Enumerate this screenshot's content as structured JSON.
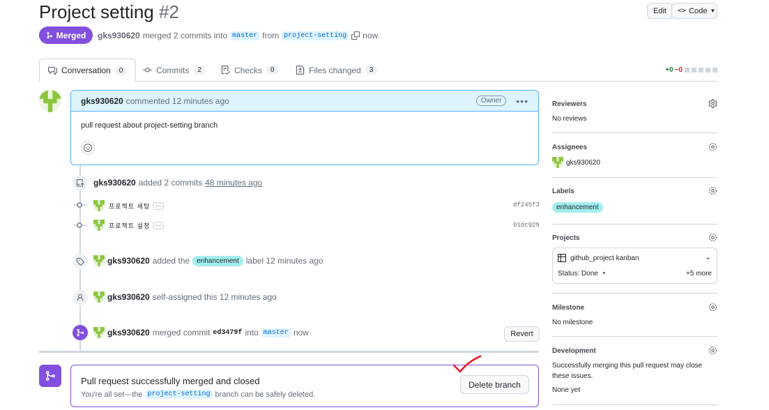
{
  "header": {
    "title": "Project setting",
    "number": "#2",
    "edit_label": "Edit",
    "code_label": "Code"
  },
  "pr_status": {
    "badge": "Merged",
    "user": "gks930620",
    "text_merged": "merged 2 commits into",
    "base_branch": "master",
    "text_from": "from",
    "head_branch": "project-setting",
    "time": "now"
  },
  "tabs": [
    {
      "label": "Conversation",
      "count": "0"
    },
    {
      "label": "Commits",
      "count": "2"
    },
    {
      "label": "Checks",
      "count": "0"
    },
    {
      "label": "Files changed",
      "count": "3"
    }
  ],
  "diffstat": {
    "add": "+0",
    "del": "−0"
  },
  "comment": {
    "user": "gks930620",
    "meta": "commented 12 minutes ago",
    "role": "Owner",
    "body": "pull request about project-setting branch"
  },
  "timeline": {
    "commits_event": {
      "user": "gks930620",
      "text": "added 2 commits",
      "time": "48 minutes ago"
    },
    "commits": [
      {
        "message": "프로젝트 세팅",
        "sha": "df245f3"
      },
      {
        "message": "프로젝트 설정",
        "sha": "01dc929"
      }
    ],
    "label_event": {
      "user": "gks930620",
      "text": "added the",
      "label": "enhancement",
      "suffix": "label 12 minutes ago"
    },
    "assign_event": {
      "user": "gks930620",
      "text": "self-assigned this 12 minutes ago"
    },
    "merge_event": {
      "user": "gks930620",
      "text": "merged commit",
      "sha": "ed3479f",
      "into": "into",
      "branch": "master",
      "time": "now",
      "revert_label": "Revert"
    }
  },
  "merge_box": {
    "title": "Pull request successfully merged and closed",
    "sub_prefix": "You're all set—the",
    "branch": "project-setting",
    "sub_suffix": "branch can be safely deleted.",
    "delete_label": "Delete branch"
  },
  "sidebar": {
    "reviewers": {
      "heading": "Reviewers",
      "value": "No reviews"
    },
    "assignees": {
      "heading": "Assignees",
      "value": "gks930620"
    },
    "labels": {
      "heading": "Labels",
      "value": "enhancement"
    },
    "projects": {
      "heading": "Projects",
      "project": "github_project kanban",
      "status": "Status: Done",
      "more": "+5 more"
    },
    "milestone": {
      "heading": "Milestone",
      "value": "No milestone"
    },
    "development": {
      "heading": "Development",
      "value": "Successfully merging this pull request may close these issues.",
      "none": "None yet"
    }
  },
  "colors": {
    "merged": "#8250df",
    "link": "#0969da",
    "label_bg": "#a2eeef",
    "annotation": "#e5202a"
  }
}
